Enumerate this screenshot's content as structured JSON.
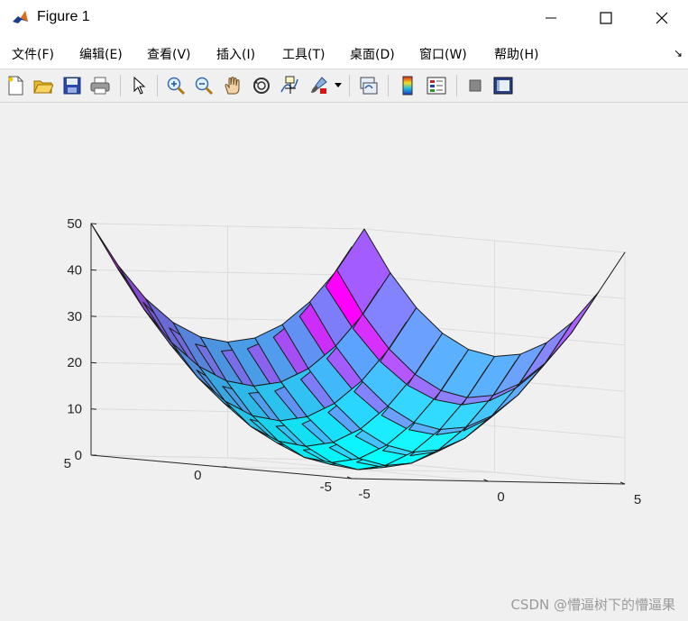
{
  "window": {
    "title": "Figure 1"
  },
  "menu": [
    "文件(F)",
    "编辑(E)",
    "查看(V)",
    "插入(I)",
    "工具(T)",
    "桌面(D)",
    "窗口(W)",
    "帮助(H)"
  ],
  "toolbar": [
    {
      "icon": "new-figure-icon"
    },
    {
      "icon": "open-file-icon"
    },
    {
      "icon": "save-icon"
    },
    {
      "icon": "print-icon"
    },
    {
      "icon": "select-pointer-icon"
    },
    {
      "icon": "zoom-in-icon"
    },
    {
      "icon": "zoom-out-icon"
    },
    {
      "icon": "pan-hand-icon"
    },
    {
      "icon": "rotate-3d-icon"
    },
    {
      "icon": "data-cursor-icon"
    },
    {
      "icon": "brush-icon"
    },
    {
      "icon": "brush-dropdown-icon"
    },
    {
      "icon": "link-plot-icon"
    },
    {
      "icon": "colorbar-icon"
    },
    {
      "icon": "legend-icon"
    },
    {
      "icon": "hide-plot-tools-icon"
    },
    {
      "icon": "show-plot-tools-icon"
    }
  ],
  "chart_data": {
    "type": "surface",
    "function": "z = x^2 + y^2",
    "x": [
      -5,
      -4,
      -3,
      -2,
      -1,
      0,
      1,
      2,
      3,
      4,
      5
    ],
    "y": [
      -5,
      -4,
      -3,
      -2,
      -1,
      0,
      1,
      2,
      3,
      4,
      5
    ],
    "zlim": [
      0,
      50
    ],
    "xlim": [
      -5,
      5
    ],
    "ylim": [
      -5,
      5
    ],
    "zticks": [
      "0",
      "10",
      "20",
      "30",
      "40",
      "50"
    ],
    "xticks": [
      "-5",
      "0",
      "5"
    ],
    "yticks": [
      "-5",
      "0",
      "5"
    ],
    "colormap": "cool",
    "grid": true
  },
  "watermark": "CSDN @懵逼树下的懵逼果"
}
